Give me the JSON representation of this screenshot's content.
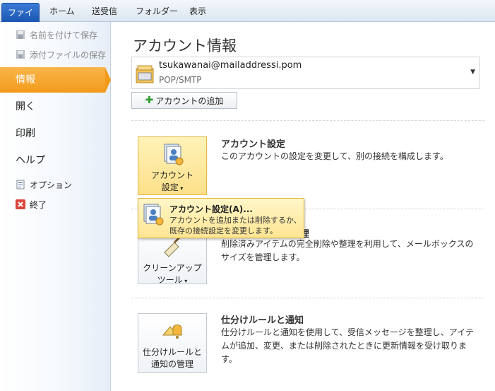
{
  "ribbon": {
    "tabs": [
      {
        "label": "ファイル"
      },
      {
        "label": "ホーム"
      },
      {
        "label": "送受信"
      },
      {
        "label": "フォルダー"
      },
      {
        "label": "表示"
      }
    ]
  },
  "sidebar": {
    "save_as": "名前を付けて保存",
    "save_attachments": "添付ファイルの保存",
    "info": "情報",
    "open": "開く",
    "print": "印刷",
    "help": "ヘルプ",
    "options": "オプション",
    "exit": "終了"
  },
  "main": {
    "title": "アカウント情報",
    "account": {
      "email": "tsukawanai@mailaddressi.pom",
      "type": "POP/SMTP"
    },
    "add_account": "アカウントの追加",
    "account_settings": {
      "button_line1": "アカウント",
      "button_line2": "設定",
      "title": "アカウント設定",
      "desc": "このアカウントの設定を変更して、別の接続を構成します。"
    },
    "cleanup": {
      "button_line1": "クリーンアップ",
      "button_line2": "ツール",
      "title_suffix": "理",
      "desc": "削除済みアイテムの完全削除や整理を利用して、メールボックスのサイズを管理します。"
    },
    "rules": {
      "button_line1": "仕分けルールと",
      "button_line2": "通知の管理",
      "title": "仕分けルールと通知",
      "desc": "仕分けルールと通知を使用して、受信メッセージを整理し、アイテムが追加、変更、または削除されたときに更新情報を受け取ります。"
    },
    "popup": {
      "title": "アカウント設定(A)...",
      "desc_line1": "アカウントを追加または削除するか、",
      "desc_line2": "既存の接続設定を変更します。"
    }
  },
  "colors": {
    "accent_orange": "#f29a1b",
    "file_tab_blue": "#1a56b2",
    "highlight_yellow": "#fde08a"
  }
}
